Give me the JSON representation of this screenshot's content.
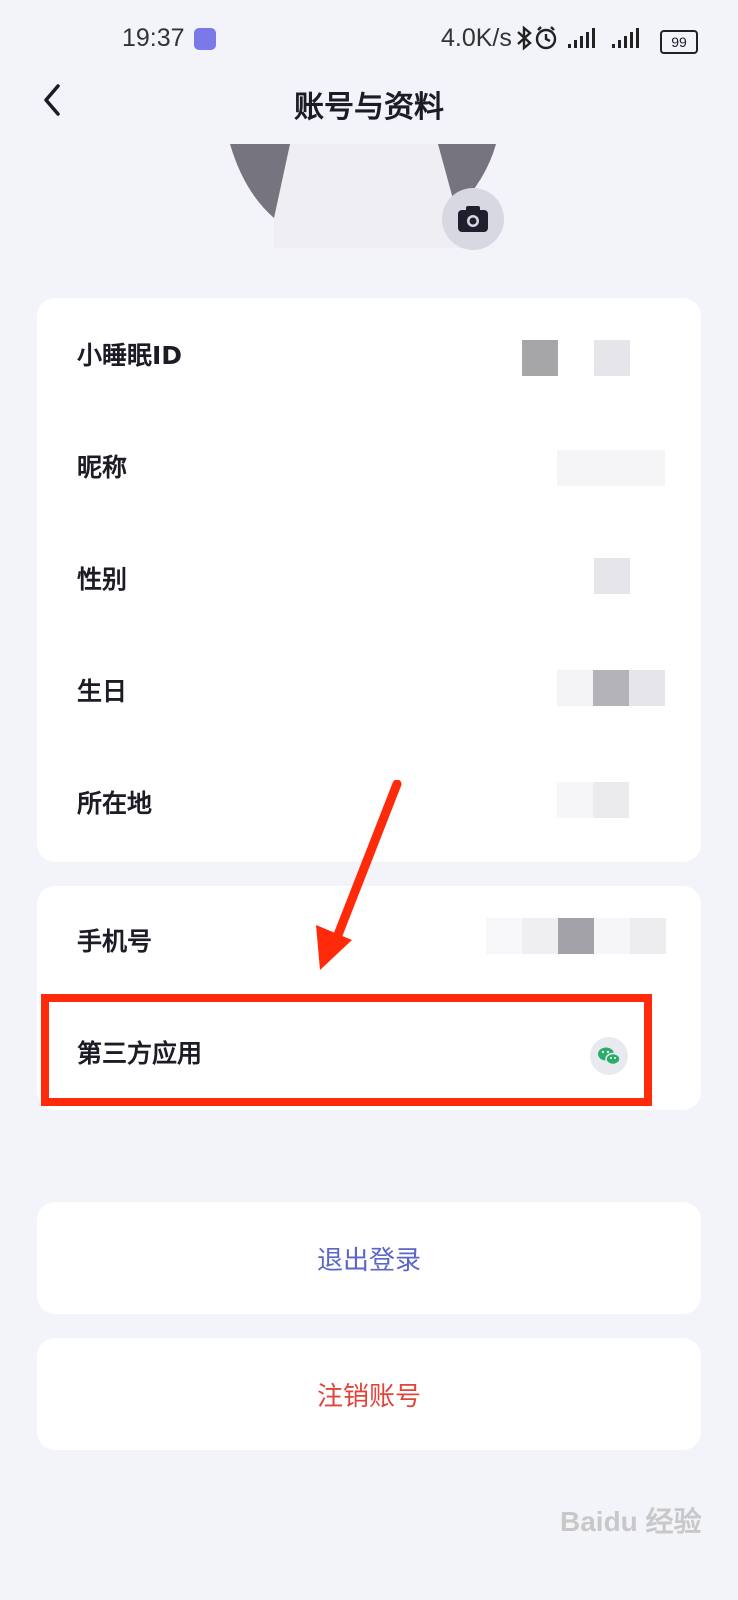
{
  "status_bar": {
    "time": "19:37",
    "net_speed": "4.0K/s",
    "icons": [
      "bluetooth-icon",
      "alarm-icon",
      "signal-5g-icon",
      "signal-4g-icon"
    ],
    "battery": "99"
  },
  "header": {
    "title": "账号与资料",
    "back_icon": "chevron-left-icon"
  },
  "profile": {
    "camera_icon": "camera-icon"
  },
  "info_card": {
    "rows": [
      {
        "label": "小睡眠ID"
      },
      {
        "label": "昵称"
      },
      {
        "label": "性别"
      },
      {
        "label": "生日"
      },
      {
        "label": "所在地"
      }
    ]
  },
  "account_card": {
    "rows": [
      {
        "label": "手机号"
      },
      {
        "label": "第三方应用",
        "icon": "wechat-icon"
      }
    ]
  },
  "actions": {
    "logout": "退出登录",
    "delete_account": "注销账号"
  },
  "colors": {
    "background": "#f3f4f9",
    "logout_text": "#5b66c8",
    "delete_text": "#e2443a",
    "annotation_red": "#ff2a0a",
    "wechat_green": "#2aae67"
  },
  "watermark": "Baidu 经验"
}
